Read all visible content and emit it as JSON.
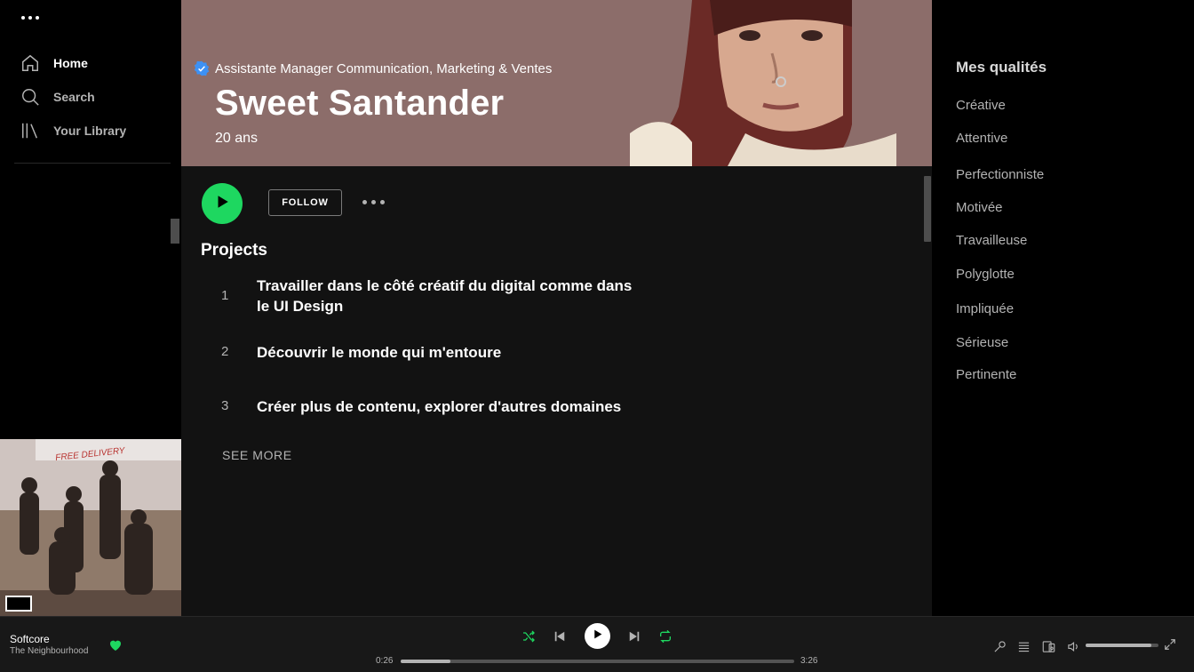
{
  "sidebar": {
    "items": [
      {
        "label": "Home",
        "icon": "home-icon"
      },
      {
        "label": "Search",
        "icon": "search-icon"
      },
      {
        "label": "Your Library",
        "icon": "library-icon"
      }
    ]
  },
  "profile": {
    "role": "Assistante Manager Communication, Marketing & Ventes",
    "name": "Sweet Santander",
    "age": "20 ans",
    "follow_label": "FOLLOW"
  },
  "projects": {
    "title": "Projects",
    "items": [
      {
        "num": "1",
        "text": "Travailler dans le côté créatif  du digital comme dans le UI Design"
      },
      {
        "num": "2",
        "text": "Découvrir le monde qui m'entoure"
      },
      {
        "num": "3",
        "text": "Créer plus de contenu, explorer d'autres domaines"
      }
    ],
    "see_more": "SEE MORE"
  },
  "qualities": {
    "title": "Mes qualités",
    "items": [
      "Créative",
      "Attentive",
      "Perfectionniste",
      "Motivée",
      "Travailleuse",
      "Polyglotte",
      "Impliquée",
      "Sérieuse",
      "Pertinente"
    ]
  },
  "player": {
    "track_title": "Softcore",
    "track_artist": "The Neighbourhood",
    "time_current": "0:26",
    "time_total": "3:26",
    "progress_fraction": 0.126,
    "volume_fraction": 0.9,
    "album_banner_text": "FREE DELIVERY"
  },
  "colors": {
    "accent": "#1ed760",
    "banner": "#8c6d6a",
    "verified": "#3d91f4"
  }
}
